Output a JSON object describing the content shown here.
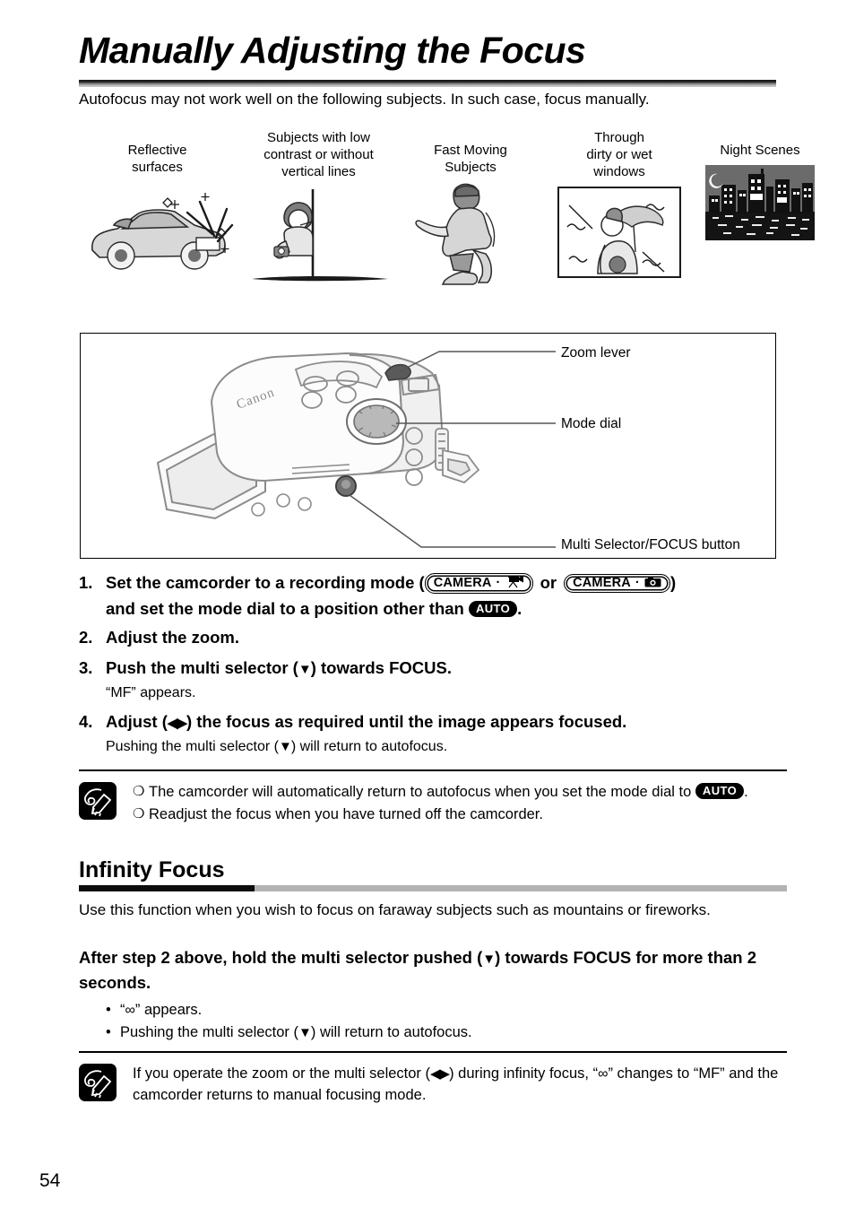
{
  "document": {
    "title": "Manually Adjusting the Focus",
    "intro": "Autofocus may not work well on the following subjects. In such case, focus manually.",
    "page_number": "54"
  },
  "subjects": {
    "items": [
      {
        "caption": "Reflective\nsurfaces",
        "art": "car-sparkle-illustration"
      },
      {
        "caption": "Subjects with low\ncontrast or without\nvertical lines",
        "art": "person-behind-pole-illustration"
      },
      {
        "caption": "Fast Moving\nSubjects",
        "art": "snowboarder-illustration"
      },
      {
        "caption": "Through\ndirty or wet\nwindows",
        "art": "umbrella-through-window-illustration"
      },
      {
        "caption": "Night Scenes",
        "art": "night-city-skyline-illustration"
      }
    ]
  },
  "diagram": {
    "brand": "Canon",
    "callouts": [
      {
        "label": "Zoom lever"
      },
      {
        "label": "Mode dial"
      },
      {
        "label": "Multi Selector/FOCUS button"
      }
    ]
  },
  "steps": [
    {
      "num": "1.",
      "text_before": "Set the camcorder to a recording mode (",
      "badge_1_label": "CAMERA",
      "badge_1_icon": "movie-camera-icon",
      "text_or": "or",
      "badge_2_label": "CAMERA",
      "badge_2_icon": "still-camera-icon",
      "text_after": ")",
      "line2_before": "and set the mode dial to a position other than",
      "badge_auto": "AUTO",
      "line2_after": "."
    },
    {
      "num": "2.",
      "text": "Adjust the zoom."
    },
    {
      "num": "3.",
      "text_before": "Push the multi selector (",
      "arrow": "▼",
      "text_after": ") towards FOCUS.",
      "sub": "“MF” appears."
    },
    {
      "num": "4.",
      "text_before": "Adjust (",
      "arrow": "◀▶",
      "text_after": ") the focus as required until the image appears focused.",
      "sub_before": "Pushing the multi selector (",
      "sub_arrow": "▼",
      "sub_after": ") will return to autofocus."
    }
  ],
  "note_top": {
    "icon": "memo-pencil-icon",
    "items": [
      {
        "mark": "❍",
        "text_before": "The camcorder will automatically return to autofocus when you set the mode dial to",
        "badge_auto": "AUTO",
        "text_after": "."
      },
      {
        "mark": "❍",
        "text": "Readjust the focus when you have turned off the camcorder."
      }
    ]
  },
  "infinity": {
    "heading": "Infinity Focus",
    "body": "Use this function when you wish to focus on faraway subjects such as mountains or fireworks.",
    "instruction_before": "After step 2 above, hold the multi selector pushed (",
    "instruction_arrow": "▼",
    "instruction_after": ") towards FOCUS for more than 2 seconds.",
    "bullets": [
      {
        "dot": "•",
        "text_before": "“",
        "symbol": "∞",
        "text_after": "” appears."
      },
      {
        "dot": "•",
        "text_before": "Pushing the multi selector (",
        "arrow": "▼",
        "text_after": ") will return to autofocus."
      }
    ]
  },
  "note_bottom": {
    "icon": "memo-pencil-icon",
    "text_before": "If you operate the zoom or the multi selector (",
    "arrow": "◀▶",
    "text_mid": ") during infinity focus, “",
    "symbol": "∞",
    "text_after": "” changes to “MF” and the camcorder returns to manual focusing mode."
  }
}
